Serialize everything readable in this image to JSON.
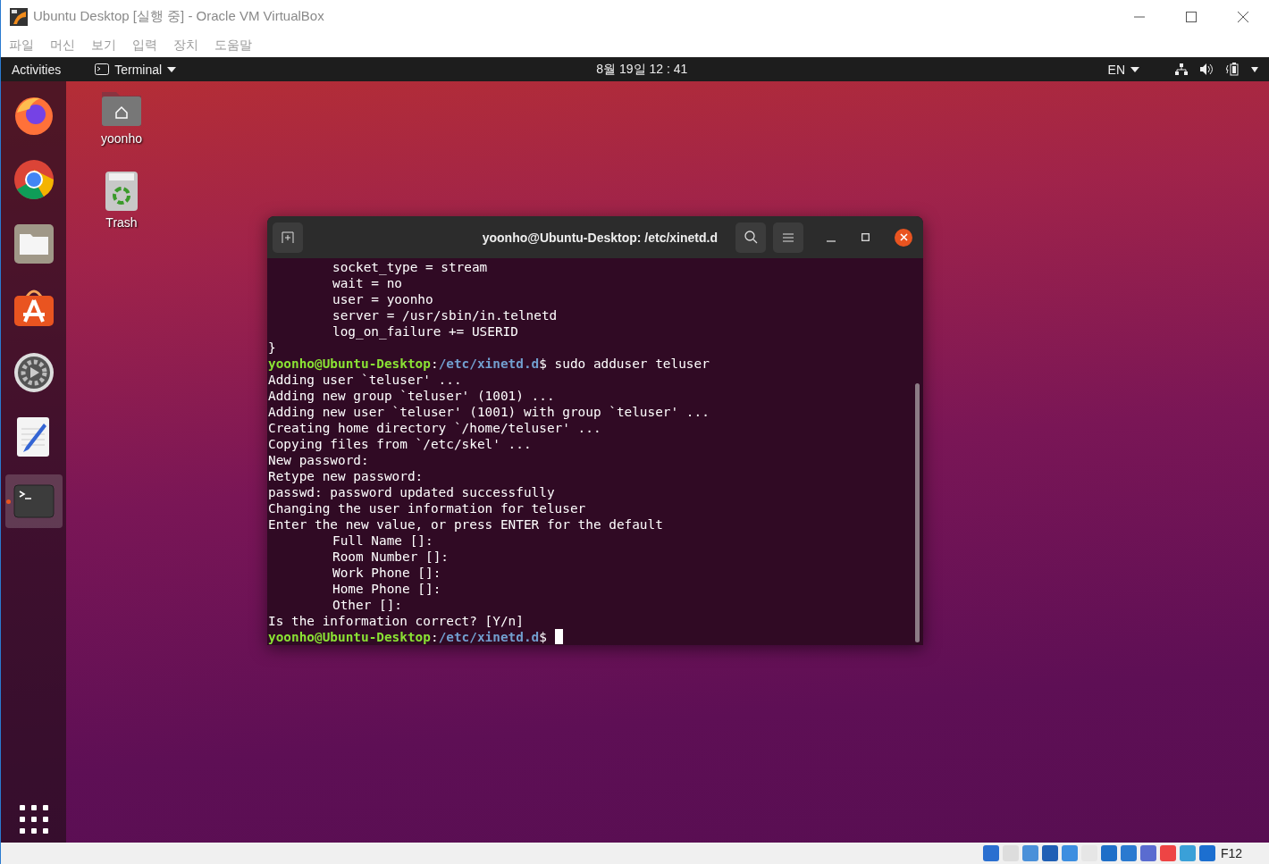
{
  "window": {
    "title": "Ubuntu Desktop [실행 중] - Oracle VM VirtualBox"
  },
  "menu": [
    "파일",
    "머신",
    "보기",
    "입력",
    "장치",
    "도움말"
  ],
  "top_bar": {
    "activities": "Activities",
    "app": "Terminal",
    "clock": "8월 19일  12 : 41",
    "language": "EN"
  },
  "dock": [
    {
      "kind": "firefox",
      "selected": false
    },
    {
      "kind": "chrome",
      "selected": false
    },
    {
      "kind": "files",
      "selected": false
    },
    {
      "kind": "store",
      "selected": false
    },
    {
      "kind": "settings",
      "selected": false
    },
    {
      "kind": "editor",
      "selected": false
    },
    {
      "kind": "terminal",
      "selected": true
    }
  ],
  "desktop_icons": [
    {
      "kind": "home",
      "label": "yoonho"
    },
    {
      "kind": "trash",
      "label": "Trash"
    }
  ],
  "terminal": {
    "title": "yoonho@Ubuntu-Desktop: /etc/xinetd.d",
    "lines": [
      {
        "kind": "text",
        "indented": true,
        "text": "socket_type = stream"
      },
      {
        "kind": "text",
        "indented": true,
        "text": "wait = no"
      },
      {
        "kind": "text",
        "indented": true,
        "text": "user = yoonho"
      },
      {
        "kind": "text",
        "indented": true,
        "text": "server = /usr/sbin/in.telnetd"
      },
      {
        "kind": "text",
        "indented": true,
        "text": "log_on_failure += USERID"
      },
      {
        "kind": "text",
        "indented": false,
        "text": "}"
      },
      {
        "kind": "prompt",
        "user": "yoonho@Ubuntu-Desktop",
        "colon": ":",
        "path": "/etc/xinetd.d",
        "sign": "$",
        "command": "sudo adduser teluser",
        "cursor": false
      },
      {
        "kind": "text",
        "indented": false,
        "text": "Adding user `teluser' ..."
      },
      {
        "kind": "text",
        "indented": false,
        "text": "Adding new group `teluser' (1001) ..."
      },
      {
        "kind": "text",
        "indented": false,
        "text": "Adding new user `teluser' (1001) with group `teluser' ..."
      },
      {
        "kind": "text",
        "indented": false,
        "text": "Creating home directory `/home/teluser' ..."
      },
      {
        "kind": "text",
        "indented": false,
        "text": "Copying files from `/etc/skel' ..."
      },
      {
        "kind": "text",
        "indented": false,
        "text": "New password:"
      },
      {
        "kind": "text",
        "indented": false,
        "text": "Retype new password:"
      },
      {
        "kind": "text",
        "indented": false,
        "text": "passwd: password updated successfully"
      },
      {
        "kind": "text",
        "indented": false,
        "text": "Changing the user information for teluser"
      },
      {
        "kind": "text",
        "indented": false,
        "text": "Enter the new value, or press ENTER for the default"
      },
      {
        "kind": "text",
        "indented": true,
        "text": "Full Name []:"
      },
      {
        "kind": "text",
        "indented": true,
        "text": "Room Number []:"
      },
      {
        "kind": "text",
        "indented": true,
        "text": "Work Phone []:"
      },
      {
        "kind": "text",
        "indented": true,
        "text": "Home Phone []:"
      },
      {
        "kind": "text",
        "indented": true,
        "text": "Other []:"
      },
      {
        "kind": "text",
        "indented": false,
        "text": "Is the information correct? [Y/n]"
      },
      {
        "kind": "prompt",
        "user": "yoonho@Ubuntu-Desktop",
        "colon": ":",
        "path": "/etc/xinetd.d",
        "sign": "$",
        "cursor": true
      }
    ]
  },
  "status_bar": {
    "host_key": "F12"
  }
}
